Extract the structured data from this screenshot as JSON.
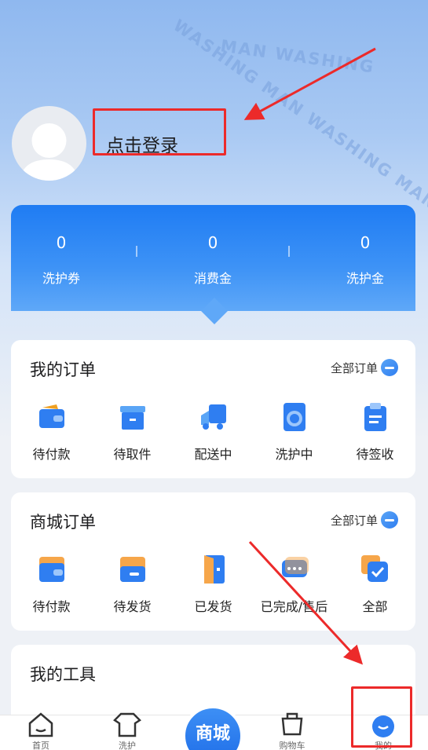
{
  "watermark": {
    "text": "WASHING MAN WASHING MAN WASHING"
  },
  "profile": {
    "login_label": "点击登录"
  },
  "wallet": {
    "items": [
      {
        "value": "0",
        "label": "洗护券"
      },
      {
        "value": "0",
        "label": "消费金"
      },
      {
        "value": "0",
        "label": "洗护金"
      }
    ]
  },
  "my_orders": {
    "title": "我的订单",
    "link": "全部订单",
    "items": [
      {
        "label": "待付款",
        "icon": "wallet-icon"
      },
      {
        "label": "待取件",
        "icon": "box-icon"
      },
      {
        "label": "配送中",
        "icon": "truck-icon"
      },
      {
        "label": "洗护中",
        "icon": "washer-icon"
      },
      {
        "label": "待签收",
        "icon": "clipboard-icon"
      }
    ]
  },
  "mall_orders": {
    "title": "商城订单",
    "link": "全部订单",
    "items": [
      {
        "label": "待付款",
        "icon": "wallet-icon"
      },
      {
        "label": "待发货",
        "icon": "package-icon"
      },
      {
        "label": "已发货",
        "icon": "door-icon"
      },
      {
        "label": "已完成/售后",
        "icon": "chat-icon"
      },
      {
        "label": "全部",
        "icon": "check-card-icon"
      }
    ]
  },
  "tools": {
    "title": "我的工具"
  },
  "tabbar": {
    "items": [
      {
        "label": "首页",
        "icon": "home-icon"
      },
      {
        "label": "洗护",
        "icon": "shirt-icon"
      },
      {
        "label": "商城",
        "icon": "mall-icon"
      },
      {
        "label": "购物车",
        "icon": "cart-icon"
      },
      {
        "label": "我的",
        "icon": "profile-icon"
      }
    ]
  },
  "colors": {
    "accent": "#1f7cf3",
    "annotation": "#ec2a2a"
  }
}
